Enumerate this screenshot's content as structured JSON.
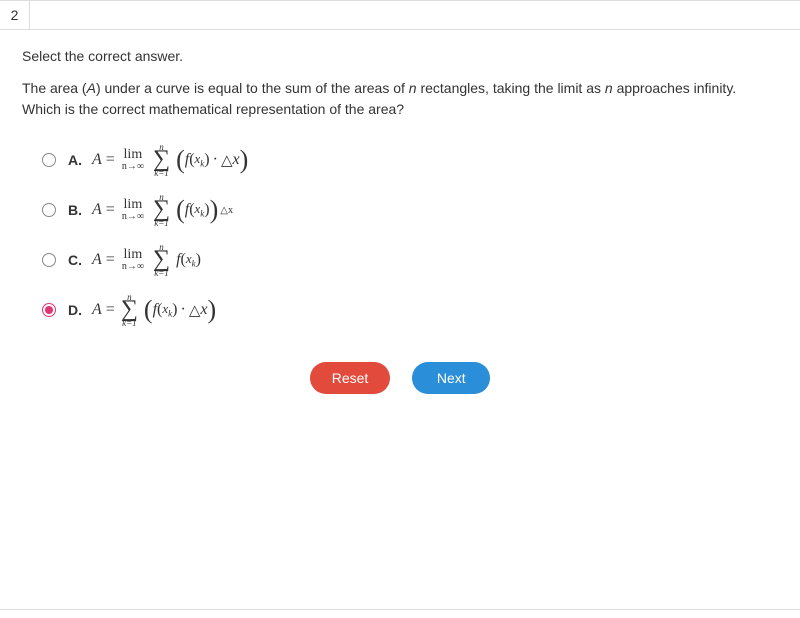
{
  "question_number": "2",
  "instruction": "Select the correct answer.",
  "question_prefix": "The area (",
  "question_A": "A",
  "question_mid1": ") under a curve is equal to the sum of the areas of ",
  "question_n1": "n",
  "question_mid2": " rectangles, taking the limit as ",
  "question_n2": "n",
  "question_mid3": " approaches infinity. Which is the correct mathematical representation of the area?",
  "options": {
    "a": {
      "label": "A."
    },
    "b": {
      "label": "B."
    },
    "c": {
      "label": "C."
    },
    "d": {
      "label": "D."
    }
  },
  "selected": "d",
  "math": {
    "A": "A",
    "eq": "=",
    "lim": "lim",
    "lim_sub": "n→∞",
    "sigma_top": "n",
    "sigma": "∑",
    "sigma_bot": "k=1",
    "f": "f",
    "lp": "(",
    "rp": ")",
    "x": "x",
    "k": "k",
    "dot": "·",
    "Delta": "△",
    "dx": "x"
  },
  "buttons": {
    "reset": "Reset",
    "next": "Next"
  }
}
